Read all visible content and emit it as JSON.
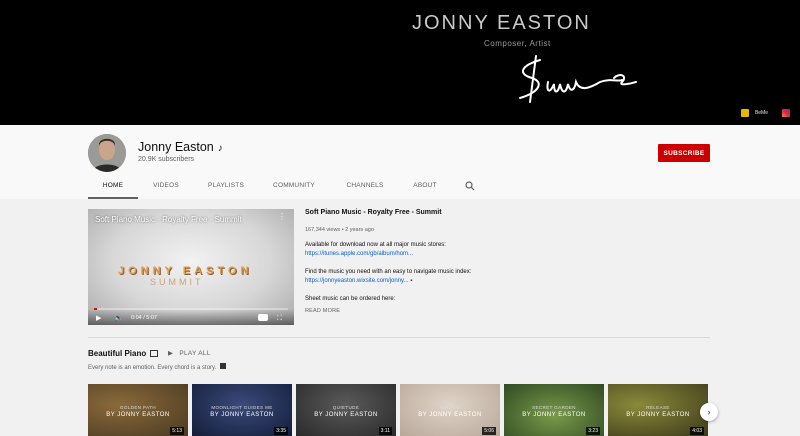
{
  "banner": {
    "title": "JONNY EASTON",
    "subtitle": "Composer, Artist",
    "links": [
      {
        "icon": "bandcamp-icon",
        "label": "BeMe"
      },
      {
        "icon": "instagram-icon",
        "label": ""
      }
    ]
  },
  "channel": {
    "name": "Jonny Easton",
    "note_icon": "♪",
    "subscribers": "20.9K subscribers",
    "subscribe_label": "SUBSCRIBE"
  },
  "tabs": [
    {
      "label": "HOME",
      "active": true
    },
    {
      "label": "VIDEOS"
    },
    {
      "label": "PLAYLISTS"
    },
    {
      "label": "COMMUNITY"
    },
    {
      "label": "CHANNELS"
    },
    {
      "label": "ABOUT"
    }
  ],
  "featured": {
    "player_title": "Soft Piano Music - Royalty Free - Summit",
    "overlay_line1": "JONNY EASTON",
    "overlay_line2": "SUMMIT",
    "time": "0:04 / 5:07",
    "progress": 0.013,
    "title": "Soft Piano Music - Royalty Free - Summit",
    "meta": "167,344 views • 2 years ago",
    "desc1": "Available for download now at all major music stores:",
    "link1": "https://itunes.apple.com/gb/album/hom...",
    "desc2": "Find the music you need with an easy to navigate music index:",
    "link2": "https://jonnyeaston.wixsite.com/jonny...",
    "desc3": "Sheet music can be ordered here:",
    "read_more": "READ MORE"
  },
  "section": {
    "title": "Beautiful Piano",
    "play_all": "PLAY ALL",
    "subtitle": "Every note is an emotion. Every chord is a story.",
    "videos": [
      {
        "line1": "GOLDEN PATH",
        "line2": "BY JONNY EASTON",
        "duration": "5:13",
        "bg": "#4a3a22"
      },
      {
        "line1": "MOONLIGHT GUIDES ME",
        "line2": "BY JONNY EASTON",
        "duration": "3:35",
        "bg": "#141e3a"
      },
      {
        "line1": "QUIETUDE",
        "line2": "BY JONNY EASTON",
        "duration": "3:11",
        "bg": "#2a2a2a"
      },
      {
        "line1": "SOLACE",
        "line2": "BY JONNY EASTON",
        "duration": "5:06",
        "bg": "#b8a89a"
      },
      {
        "line1": "SECRET GARDEN",
        "line2": "BY JONNY EASTON",
        "duration": "3:23",
        "bg": "#2f4a22"
      },
      {
        "line1": "RELEASE",
        "line2": "BY JONNY EASTON",
        "duration": "4:03",
        "bg": "#3d3a1a"
      }
    ]
  },
  "colors": {
    "subscribe": "#cc0000",
    "link": "#065fd4",
    "progress": "#ff0000"
  }
}
